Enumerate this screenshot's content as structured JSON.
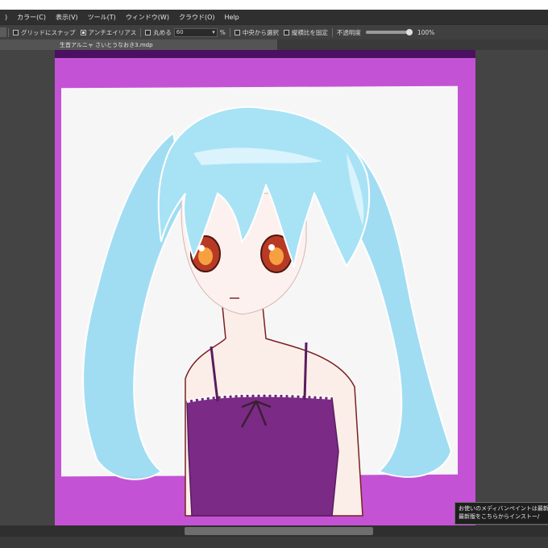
{
  "menubar": {
    "items": [
      ")",
      "カラー(C)",
      "表示(V)",
      "ツール(T)",
      "ウィンドウ(W)",
      "クラウド(O)",
      "Help"
    ]
  },
  "toolbar": {
    "grid_snap_label": "グリッドにスナップ",
    "antialias_label": "アンチエイリアス",
    "round_label": "丸める",
    "round_value": "60",
    "percent_unit": "%",
    "center_select_label": "中央から選択",
    "fix_aspect_label": "縦横比を固定",
    "opacity_label": "不透明度",
    "opacity_value": "100%",
    "opacity_fraction": 1.0,
    "grid_snap_checked": false,
    "antialias_checked": true,
    "round_checked": false,
    "center_select_checked": false,
    "fix_aspect_checked": false
  },
  "document_tab": {
    "title": "生首アルニャ さいとうなおき3.mdp"
  },
  "toast": {
    "line1": "お使いのメディバンペイントは最新",
    "line2": "最新版をこちらからインストー/"
  },
  "colors": {
    "canvas_border": "#c353d4",
    "paper": "#f6f6f7",
    "hair": "#8fd8f0",
    "dress": "#7b2a86"
  }
}
